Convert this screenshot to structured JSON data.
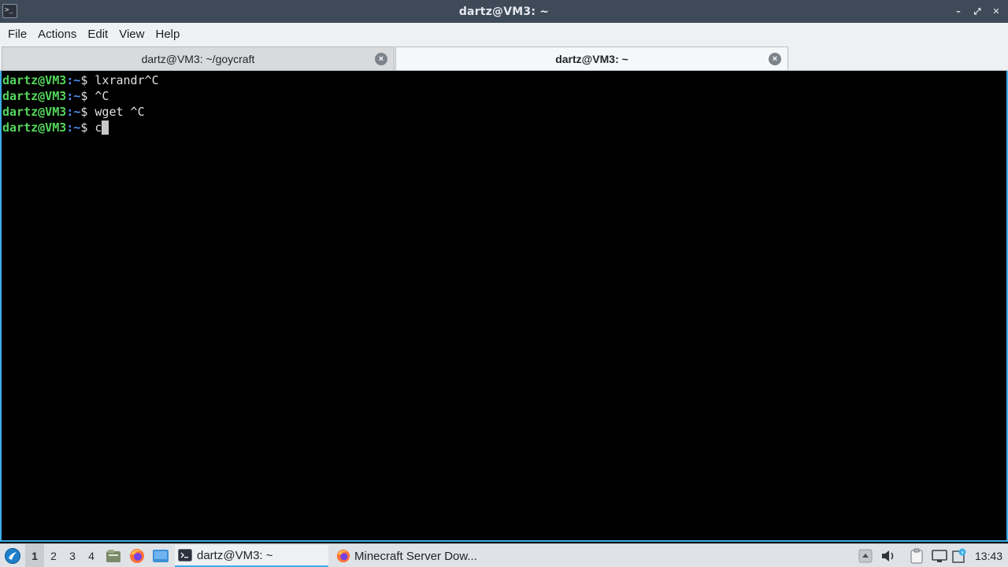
{
  "window": {
    "title": "dartz@VM3: ~",
    "app_icon_text": ">_",
    "controls": {
      "minimize": "–",
      "maximize": "⤢",
      "close": "✕"
    }
  },
  "menubar": {
    "items": [
      "File",
      "Actions",
      "Edit",
      "View",
      "Help"
    ]
  },
  "tabs": [
    {
      "label": "dartz@VM3: ~/goycraft",
      "active": false
    },
    {
      "label": "dartz@VM3: ~",
      "active": true
    }
  ],
  "terminal": {
    "prompt_user": "dartz@VM3",
    "prompt_path": ":~",
    "prompt_symbol": "$ ",
    "lines": [
      {
        "cmd": "lxrandr^C"
      },
      {
        "cmd": "^C"
      },
      {
        "cmd": "wget ^C"
      },
      {
        "cmd": "c"
      }
    ],
    "colors": {
      "user": "#54d65a",
      "path": "#4e8ff0",
      "text": "#e0e0e0",
      "accent": "#3daee9"
    }
  },
  "taskbar": {
    "workspaces": [
      "1",
      "2",
      "3",
      "4"
    ],
    "current_workspace": "1",
    "tasks": [
      {
        "label": "dartz@VM3: ~",
        "icon": "terminal-icon",
        "active": true
      },
      {
        "label": "Minecraft Server Dow...",
        "icon": "firefox-icon",
        "active": false
      }
    ],
    "clock": "13:43"
  }
}
